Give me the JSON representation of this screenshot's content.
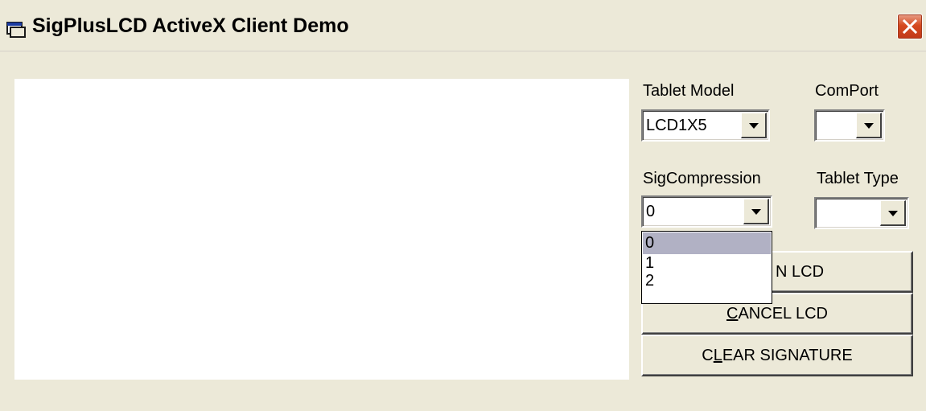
{
  "window": {
    "title": "SigPlusLCD ActiveX Client Demo",
    "icons": {
      "app": "app-window-icon",
      "close": "close-icon"
    },
    "colors": {
      "face": "#ece9d8",
      "close": "#d6491e"
    }
  },
  "signature_pad": {},
  "tablet_model": {
    "label": "Tablet Model",
    "value": "LCD1X5"
  },
  "comport": {
    "label": "ComPort",
    "value": ""
  },
  "sig_compression": {
    "label": "SigCompression",
    "value": "0",
    "options": [
      "0",
      "1",
      "2"
    ],
    "highlighted": "0"
  },
  "tablet_type": {
    "label": "Tablet Type",
    "value": ""
  },
  "buttons": {
    "sign": {
      "label": "N LCD"
    },
    "cancel": {
      "accel": "C",
      "rest": "ANCEL LCD"
    },
    "clear": {
      "pre": "C",
      "accel": "L",
      "rest": "EAR SIGNATURE"
    }
  }
}
